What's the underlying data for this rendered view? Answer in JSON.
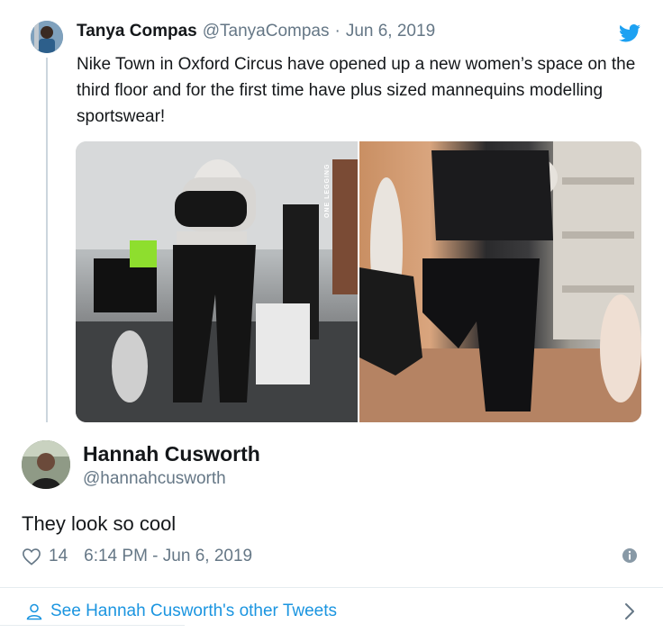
{
  "quoted_tweet": {
    "author_name": "Tanya Compas",
    "handle": "@TanyaCompas",
    "separator": "·",
    "date": "Jun 6, 2019",
    "text": "Nike Town in Oxford Circus have opened up a new women’s space on the third floor and for the first time have plus sized mannequins modelling sportswear!",
    "photo_shelf_text": "ONE LEGGING",
    "photos": [
      "store-mannequin-photo",
      "yoga-mannequins-photo"
    ]
  },
  "tweet": {
    "author_name": "Hannah Cusworth",
    "handle": "@hannahcusworth",
    "text": "They look so cool",
    "like_count": "14",
    "timestamp": "6:14 PM - Jun 6, 2019"
  },
  "footer": {
    "link_text": "See Hannah Cusworth's other Tweets"
  },
  "colors": {
    "link_blue": "#1b95e0",
    "secondary_text": "#657786",
    "primary_text": "#14171a",
    "twitter_blue": "#1da1f2"
  },
  "icons": [
    "twitter-bird-icon",
    "heart-icon",
    "info-icon",
    "person-icon",
    "chevron-right-icon"
  ]
}
